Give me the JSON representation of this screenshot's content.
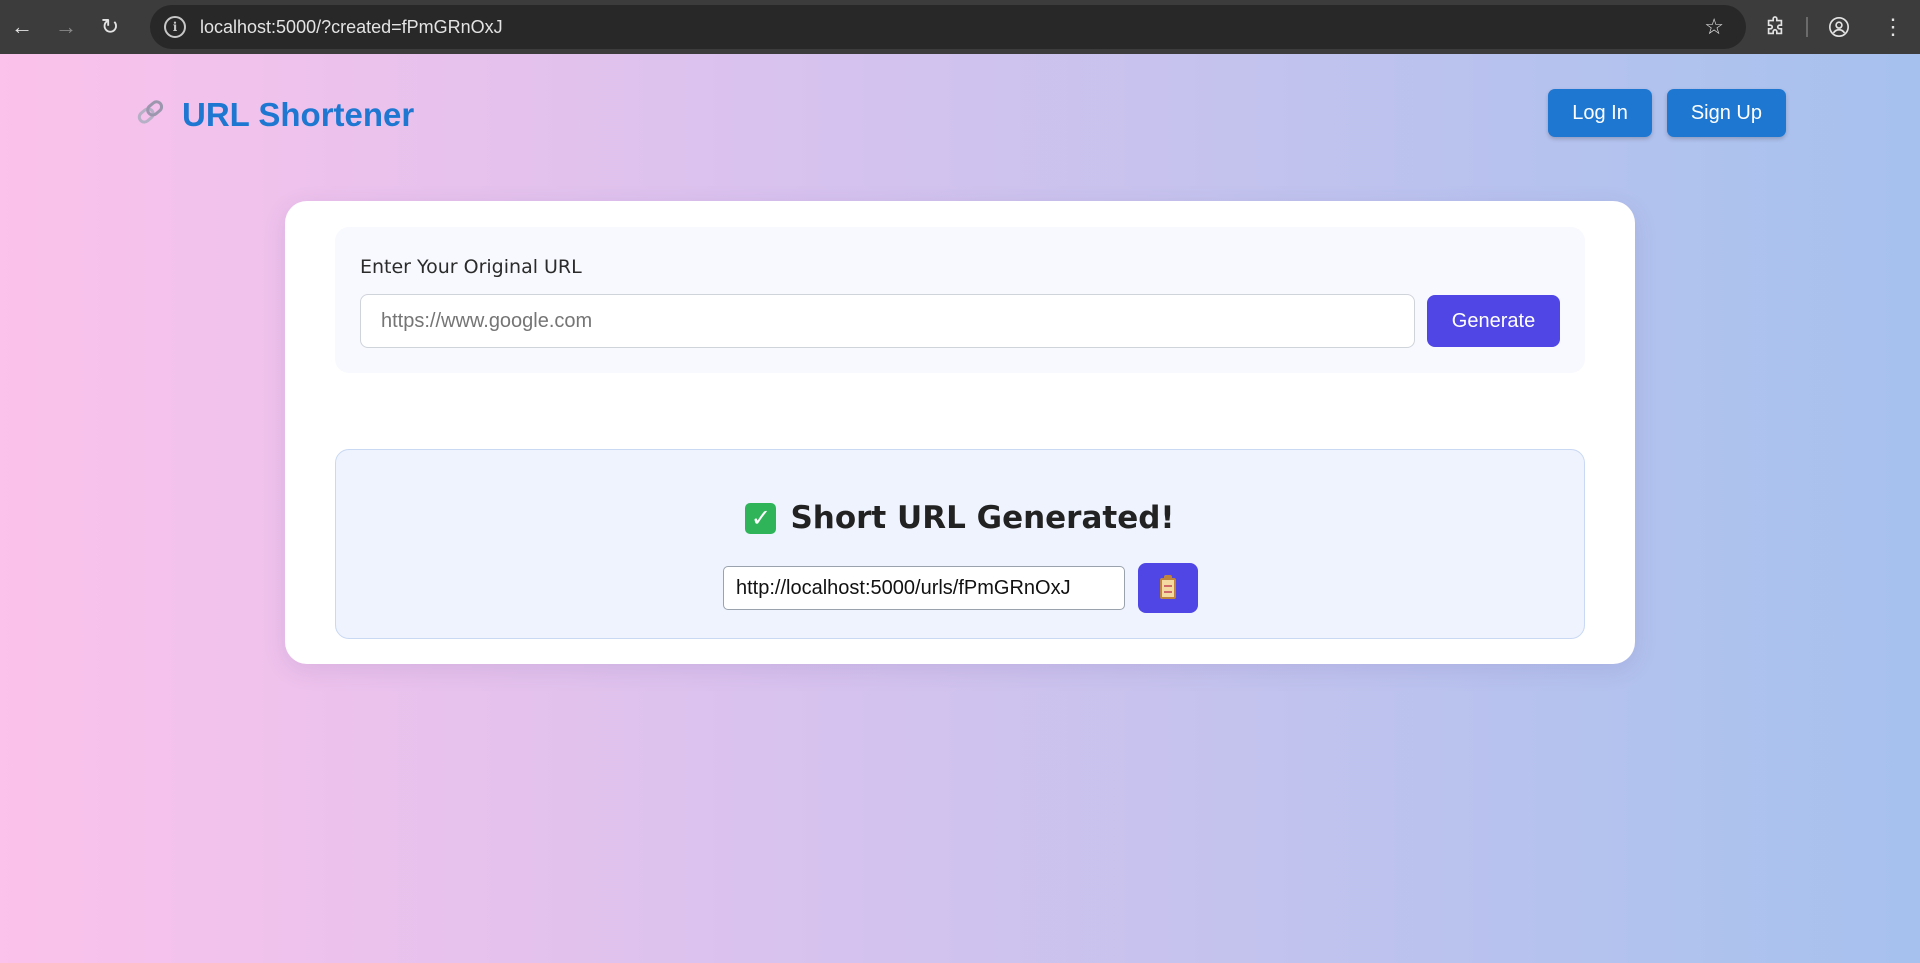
{
  "browser": {
    "url": "localhost:5000/?created=fPmGRnOxJ",
    "icons": {
      "back": "arrow-left",
      "forward": "arrow-right",
      "reload": "reload",
      "site_info": "info",
      "bookmark": "star",
      "extensions": "puzzle",
      "profile": "account-circle",
      "menu": "more-vert"
    }
  },
  "header": {
    "logo_icon": "link",
    "title": "URL Shortener",
    "login_label": "Log In",
    "signup_label": "Sign Up"
  },
  "form": {
    "label": "Enter Your Original URL",
    "placeholder": "https://www.google.com",
    "value": "",
    "button_label": "Generate"
  },
  "result": {
    "icon": "check-mark",
    "heading": "Short URL Generated!",
    "short_url": "http://localhost:5000/urls/fPmGRnOxJ",
    "copy_icon": "clipboard"
  },
  "colors": {
    "brand": "#1e78d2",
    "accent": "#4f46e5",
    "success": "#2fb45a"
  }
}
